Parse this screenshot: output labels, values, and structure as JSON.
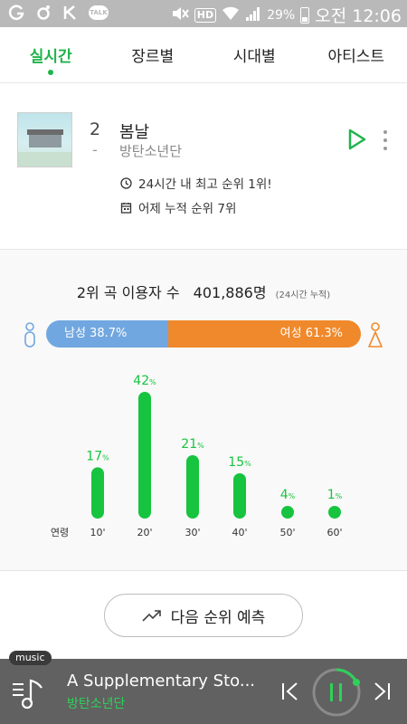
{
  "status": {
    "battery": "29%",
    "clock": "오전 12:06",
    "hd": "HD",
    "talk": "TALK"
  },
  "tabs": [
    {
      "label": "실시간",
      "active": true
    },
    {
      "label": "장르별",
      "active": false
    },
    {
      "label": "시대별",
      "active": false
    },
    {
      "label": "아티스트",
      "active": false
    }
  ],
  "song": {
    "rank": "2",
    "rank_change": "-",
    "title": "봄날",
    "artist": "방탄소년단",
    "info1": "24시간 내 최고 순위 1위!",
    "info2": "어제 누적 순위 7위"
  },
  "stats": {
    "headline": "2위 곡 이용자 수",
    "count": "401,886명",
    "note": "(24시간 누적)",
    "male_label": "남성 38.7%",
    "female_label": "여성 61.3%",
    "male_pct": 38.7,
    "female_pct": 61.3
  },
  "chart_data": {
    "type": "bar",
    "xlabel": "연령",
    "categories": [
      "10'",
      "20'",
      "30'",
      "40'",
      "50'",
      "60'"
    ],
    "values": [
      17,
      42,
      21,
      15,
      4,
      1
    ],
    "unit": "%"
  },
  "predict_button": {
    "label": "다음 순위 예측"
  },
  "player": {
    "tag": "music",
    "title": "A Supplementary Sto...",
    "artist": "방탄소년단"
  },
  "colors": {
    "accent": "#1fb44a",
    "male": "#71a7e0",
    "female": "#f0892b",
    "bar": "#17c43f",
    "player_bg": "#616161"
  }
}
